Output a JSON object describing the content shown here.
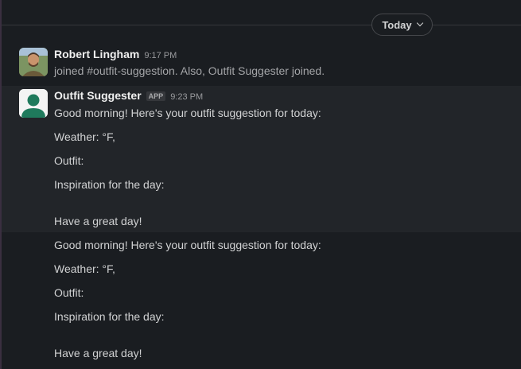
{
  "date_divider": {
    "label": "Today"
  },
  "messages": [
    {
      "author": "Robert Lingham",
      "time": "9:17 PM",
      "text": "joined #outfit-suggestion. Also, Outfit Suggester joined."
    },
    {
      "author": "Outfit Suggester",
      "badge": "APP",
      "time": "9:23 PM",
      "lines": [
        "Good morning! Here's your outfit suggestion for today:",
        "Weather: °F,",
        "Outfit:",
        "Inspiration for the day:",
        "Have a great day!"
      ]
    },
    {
      "lines": [
        "Good morning! Here's your outfit suggestion for today:",
        "Weather: °F,",
        "Outfit:",
        "Inspiration for the day:",
        "Have a great day!"
      ]
    }
  ]
}
